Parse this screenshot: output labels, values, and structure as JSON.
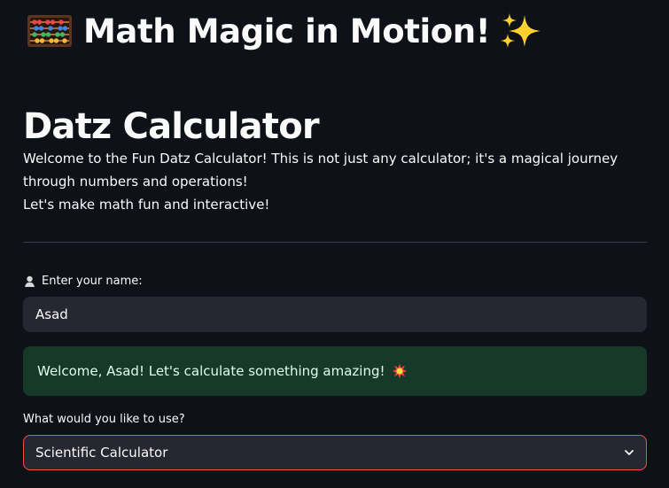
{
  "hero": {
    "icon": "abacus-icon",
    "title": "Math Magic in Motion!",
    "trailing_icon": "sparkles-icon"
  },
  "section": {
    "title": "Datz Calculator"
  },
  "intro": {
    "line1": "Welcome to the Fun Datz Calculator! This is not just any calculator; it's a magical journey through numbers and operations!",
    "line2": "Let's make math fun and interactive!"
  },
  "name_input": {
    "icon": "person-icon",
    "label": "Enter your name:",
    "value": "Asad",
    "placeholder": ""
  },
  "greeting": {
    "text": "Welcome, Asad! Let's calculate something amazing!",
    "icon": "boom-icon"
  },
  "select": {
    "label": "What would you like to use?",
    "selected_value": "Scientific Calculator",
    "icon": "chevron-down-icon"
  },
  "colors": {
    "app_background": "#0e1117",
    "input_background": "#262730",
    "success_background": "#173928",
    "focus_border": "#ff4b4b"
  }
}
